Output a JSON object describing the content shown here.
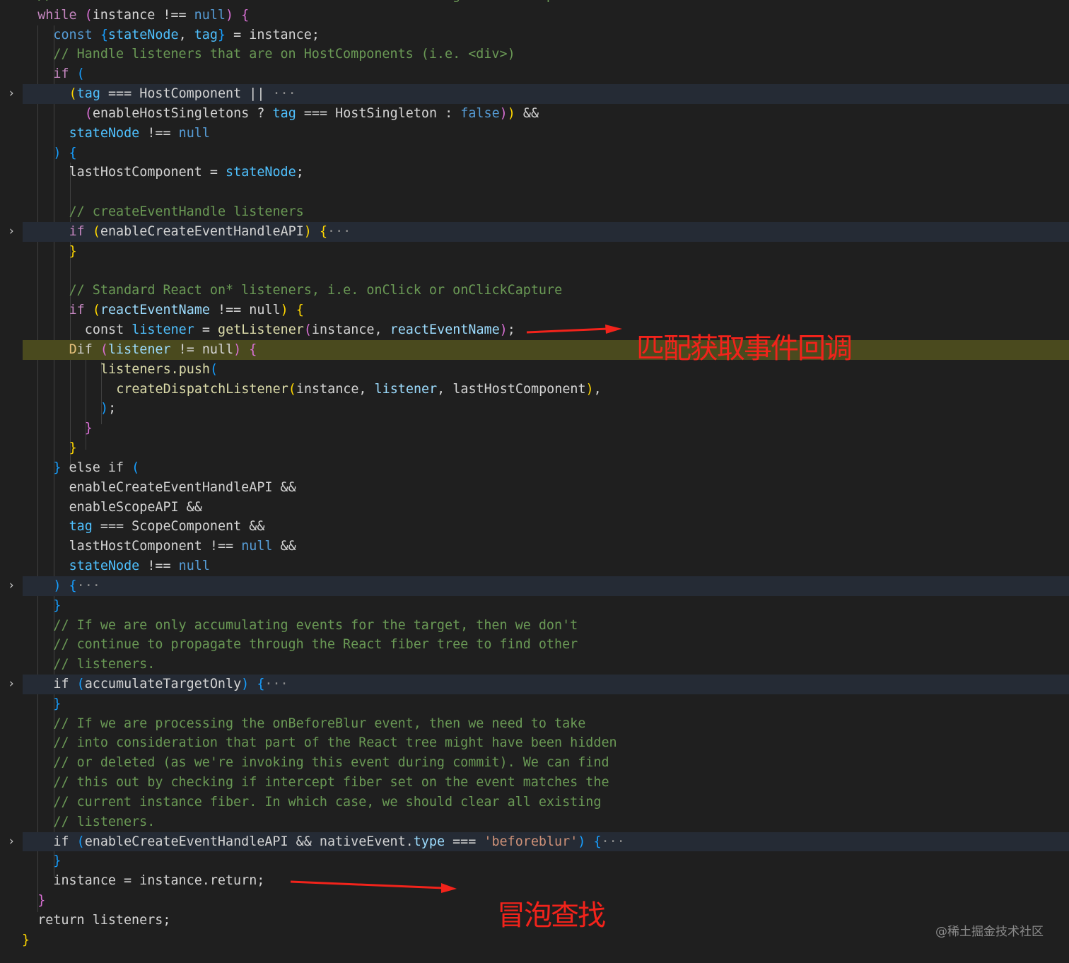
{
  "editor": {
    "lines": [
      {
        "indent": 2,
        "tokens": [
          [
            "// Accumulate all instances and listeners via the target -> root path.",
            "cm"
          ]
        ]
      },
      {
        "indent": 2,
        "tokens": [
          [
            "while",
            "kw"
          ],
          [
            " ",
            "p"
          ],
          [
            "(",
            "b2"
          ],
          [
            "instance",
            "p"
          ],
          [
            " !== ",
            "p"
          ],
          [
            "null",
            "st"
          ],
          [
            ")",
            "b2"
          ],
          [
            " ",
            "p"
          ],
          [
            "{",
            "b2"
          ]
        ]
      },
      {
        "indent": 4,
        "tokens": [
          [
            "const",
            "st"
          ],
          [
            " ",
            "p"
          ],
          [
            "{",
            "b3"
          ],
          [
            "stateNode",
            "c"
          ],
          [
            ", ",
            "p"
          ],
          [
            "tag",
            "c"
          ],
          [
            "}",
            "b3"
          ],
          [
            " = instance;",
            "p"
          ]
        ]
      },
      {
        "indent": 4,
        "tokens": [
          [
            "// Handle listeners that are on HostComponents (i.e. <div>)",
            "cm"
          ]
        ]
      },
      {
        "indent": 4,
        "tokens": [
          [
            "if",
            "kw"
          ],
          [
            " ",
            "p"
          ],
          [
            "(",
            "b3"
          ]
        ]
      },
      {
        "indent": 6,
        "folded": true,
        "tokens": [
          [
            "(",
            "b1"
          ],
          [
            "tag",
            "c"
          ],
          [
            " === HostComponent ||",
            "p"
          ],
          [
            " ···",
            "el"
          ]
        ]
      },
      {
        "indent": 8,
        "tokens": [
          [
            "(",
            "b2"
          ],
          [
            "enableHostSingletons ? ",
            "p"
          ],
          [
            "tag",
            "c"
          ],
          [
            " === HostSingleton : ",
            "p"
          ],
          [
            "false",
            "st"
          ],
          [
            ")",
            "b2"
          ],
          [
            ")",
            "b1"
          ],
          [
            " &&",
            "p"
          ]
        ]
      },
      {
        "indent": 6,
        "tokens": [
          [
            "stateNode",
            "c"
          ],
          [
            " !== ",
            "p"
          ],
          [
            "null",
            "st"
          ]
        ]
      },
      {
        "indent": 4,
        "tokens": [
          [
            ")",
            "b3"
          ],
          [
            " ",
            "p"
          ],
          [
            "{",
            "b3"
          ]
        ]
      },
      {
        "indent": 6,
        "tokens": [
          [
            "lastHostComponent = ",
            "p"
          ],
          [
            "stateNode",
            "c"
          ],
          [
            ";",
            "p"
          ]
        ]
      },
      {
        "indent": 0,
        "tokens": []
      },
      {
        "indent": 6,
        "tokens": [
          [
            "// createEventHandle listeners",
            "cm"
          ]
        ]
      },
      {
        "indent": 6,
        "folded": true,
        "tokens": [
          [
            "if",
            "kw"
          ],
          [
            " ",
            "p"
          ],
          [
            "(",
            "b1"
          ],
          [
            "enableCreateEventHandleAPI",
            "p"
          ],
          [
            ")",
            "b1"
          ],
          [
            " ",
            "p"
          ],
          [
            "{",
            "b1"
          ],
          [
            "···",
            "el"
          ]
        ]
      },
      {
        "indent": 6,
        "tokens": [
          [
            "}",
            "b1"
          ]
        ]
      },
      {
        "indent": 0,
        "tokens": []
      },
      {
        "indent": 6,
        "tokens": [
          [
            "// Standard React on* listeners, i.e. onClick or onClickCapture",
            "cm"
          ]
        ]
      },
      {
        "indent": 6,
        "tokens": [
          [
            "if",
            "kw"
          ],
          [
            " ",
            "p"
          ],
          [
            "(",
            "b1"
          ],
          [
            "reactEventName",
            "v"
          ],
          [
            " !== null",
            "p"
          ],
          [
            ")",
            "b1"
          ],
          [
            " ",
            "p"
          ],
          [
            "{",
            "b1"
          ]
        ]
      },
      {
        "indent": 8,
        "tokens": [
          [
            "const",
            "p"
          ],
          [
            " ",
            "p"
          ],
          [
            "listener",
            "c"
          ],
          [
            " = ",
            "p"
          ],
          [
            "getListener",
            "f"
          ],
          [
            "(",
            "b2"
          ],
          [
            "instance, ",
            "p"
          ],
          [
            "reactEventName",
            "v"
          ],
          [
            ")",
            "b2"
          ],
          [
            ";",
            "p"
          ]
        ]
      },
      {
        "indent": 6,
        "highlight": true,
        "tokens": [
          [
            "D",
            "cur"
          ],
          [
            "if",
            "p"
          ],
          [
            " ",
            "p"
          ],
          [
            "(",
            "b2"
          ],
          [
            "listener",
            "v"
          ],
          [
            " != null",
            "p"
          ],
          [
            ")",
            "b2"
          ],
          [
            " ",
            "p"
          ],
          [
            "{",
            "b2"
          ]
        ]
      },
      {
        "indent": 10,
        "tokens": [
          [
            "listeners.push",
            "f"
          ],
          [
            "(",
            "b3"
          ]
        ]
      },
      {
        "indent": 12,
        "tokens": [
          [
            "createDispatchListener",
            "f"
          ],
          [
            "(",
            "b1"
          ],
          [
            "instance, ",
            "p"
          ],
          [
            "listener",
            "v"
          ],
          [
            ", lastHostComponent",
            "p"
          ],
          [
            ")",
            "b1"
          ],
          [
            ",",
            "p"
          ]
        ]
      },
      {
        "indent": 10,
        "tokens": [
          [
            ")",
            "b3"
          ],
          [
            ";",
            "p"
          ]
        ]
      },
      {
        "indent": 8,
        "tokens": [
          [
            "}",
            "b2"
          ]
        ]
      },
      {
        "indent": 6,
        "tokens": [
          [
            "}",
            "b1"
          ]
        ]
      },
      {
        "indent": 4,
        "tokens": [
          [
            "}",
            "b3"
          ],
          [
            " else if ",
            "p"
          ],
          [
            "(",
            "b3"
          ]
        ]
      },
      {
        "indent": 6,
        "tokens": [
          [
            "enableCreateEventHandleAPI &&",
            "p"
          ]
        ]
      },
      {
        "indent": 6,
        "tokens": [
          [
            "enableScopeAPI &&",
            "p"
          ]
        ]
      },
      {
        "indent": 6,
        "tokens": [
          [
            "tag",
            "c"
          ],
          [
            " === ScopeComponent &&",
            "p"
          ]
        ]
      },
      {
        "indent": 6,
        "tokens": [
          [
            "lastHostComponent !== ",
            "p"
          ],
          [
            "null",
            "st"
          ],
          [
            " &&",
            "p"
          ]
        ]
      },
      {
        "indent": 6,
        "tokens": [
          [
            "stateNode",
            "c"
          ],
          [
            " !== ",
            "p"
          ],
          [
            "null",
            "st"
          ]
        ]
      },
      {
        "indent": 4,
        "folded": true,
        "tokens": [
          [
            ")",
            "b3"
          ],
          [
            " ",
            "p"
          ],
          [
            "{",
            "b3"
          ],
          [
            "···",
            "el"
          ]
        ]
      },
      {
        "indent": 4,
        "tokens": [
          [
            "}",
            "b3"
          ]
        ]
      },
      {
        "indent": 4,
        "tokens": [
          [
            "// If we are only accumulating events for the target, then we don't",
            "cm"
          ]
        ]
      },
      {
        "indent": 4,
        "tokens": [
          [
            "// continue to propagate through the React fiber tree to find other",
            "cm"
          ]
        ]
      },
      {
        "indent": 4,
        "tokens": [
          [
            "// listeners.",
            "cm"
          ]
        ]
      },
      {
        "indent": 4,
        "folded": true,
        "tokens": [
          [
            "if",
            "p"
          ],
          [
            " ",
            "p"
          ],
          [
            "(",
            "b3"
          ],
          [
            "accumulateTargetOnly",
            "p"
          ],
          [
            ")",
            "b3"
          ],
          [
            " ",
            "p"
          ],
          [
            "{",
            "b3"
          ],
          [
            "···",
            "el"
          ]
        ]
      },
      {
        "indent": 4,
        "tokens": [
          [
            "}",
            "b3"
          ]
        ]
      },
      {
        "indent": 4,
        "tokens": [
          [
            "// If we are processing the onBeforeBlur event, then we need to take",
            "cm"
          ]
        ]
      },
      {
        "indent": 4,
        "tokens": [
          [
            "// into consideration that part of the React tree might have been hidden",
            "cm"
          ]
        ]
      },
      {
        "indent": 4,
        "tokens": [
          [
            "// or deleted (as we're invoking this event during commit). We can find",
            "cm"
          ]
        ]
      },
      {
        "indent": 4,
        "tokens": [
          [
            "// this out by checking if intercept fiber set on the event matches the",
            "cm"
          ]
        ]
      },
      {
        "indent": 4,
        "tokens": [
          [
            "// current instance fiber. In which case, we should clear all existing",
            "cm"
          ]
        ]
      },
      {
        "indent": 4,
        "tokens": [
          [
            "// listeners.",
            "cm"
          ]
        ]
      },
      {
        "indent": 4,
        "folded": true,
        "tokens": [
          [
            "if",
            "p"
          ],
          [
            " ",
            "p"
          ],
          [
            "(",
            "b3"
          ],
          [
            "enableCreateEventHandleAPI && nativeEvent.",
            "p"
          ],
          [
            "type",
            "v"
          ],
          [
            " === ",
            "p"
          ],
          [
            "'beforeblur'",
            "s"
          ],
          [
            ")",
            "b3"
          ],
          [
            " ",
            "p"
          ],
          [
            "{",
            "b3"
          ],
          [
            "···",
            "el"
          ]
        ]
      },
      {
        "indent": 4,
        "tokens": [
          [
            "}",
            "b3"
          ]
        ]
      },
      {
        "indent": 4,
        "tokens": [
          [
            "instance = instance.return;",
            "p"
          ]
        ]
      },
      {
        "indent": 2,
        "tokens": [
          [
            "}",
            "b2"
          ]
        ]
      },
      {
        "indent": 2,
        "tokens": [
          [
            "return listeners;",
            "p"
          ]
        ]
      },
      {
        "indent": 0,
        "tokens": [
          [
            "}",
            "b1"
          ]
        ]
      }
    ]
  },
  "annotations": {
    "match_callback": "匹配获取事件回调",
    "bubble_search": "冒泡查找",
    "color": "#f2231b"
  },
  "watermark": "@稀土掘金技术社区"
}
